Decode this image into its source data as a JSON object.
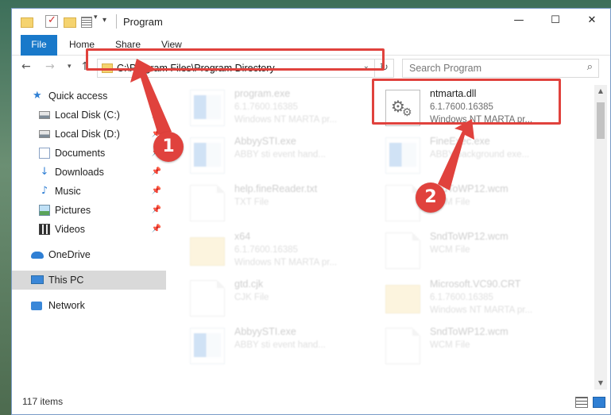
{
  "window": {
    "title": "Program",
    "controls": {
      "minimize": "—",
      "maximize": "☐",
      "close": "✕"
    }
  },
  "ribbon": {
    "tabs": [
      "File",
      "Home",
      "Share",
      "View"
    ]
  },
  "navigation": {
    "back": "←",
    "forward": "→",
    "recent": "⌄",
    "up": "↑",
    "address": "C:\\Program Files\\Program Directory",
    "refresh": "↻",
    "search_placeholder": "Search Program"
  },
  "sidebar": {
    "items": [
      {
        "label": "Quick access",
        "icon": "star-icon"
      },
      {
        "label": "Local Disk (C:)",
        "icon": "disk-icon",
        "pinned": true
      },
      {
        "label": "Local Disk (D:)",
        "icon": "disk-icon",
        "pinned": true
      },
      {
        "label": "Documents",
        "icon": "documents-icon",
        "pinned": true
      },
      {
        "label": "Downloads",
        "icon": "download-icon",
        "pinned": true
      },
      {
        "label": "Music",
        "icon": "music-icon",
        "pinned": true
      },
      {
        "label": "Pictures",
        "icon": "pictures-icon",
        "pinned": true
      },
      {
        "label": "Videos",
        "icon": "videos-icon",
        "pinned": true
      },
      {
        "label": "OneDrive",
        "icon": "cloud-icon"
      },
      {
        "label": "This PC",
        "icon": "computer-icon",
        "selected": true
      },
      {
        "label": "Network",
        "icon": "network-icon"
      }
    ],
    "pin_glyph": "📌"
  },
  "files": [
    {
      "name": "program.exe",
      "meta1": "6.1.7600.16385",
      "meta2": "Windows NT MARTA pr...",
      "type": "exe-setup",
      "faded": true
    },
    {
      "name": "ntmarta.dll",
      "meta1": "6.1.7600.16385",
      "meta2": "Windows NT MARTA pr...",
      "type": "dll",
      "faded": false
    },
    {
      "name": "AbbyySTI.exe",
      "meta1": "ABBY sti event hand...",
      "meta2": "",
      "type": "exe",
      "faded": true
    },
    {
      "name": "FineExec.exe",
      "meta1": "ABBY background exe...",
      "meta2": "",
      "type": "exe",
      "faded": true
    },
    {
      "name": "help.fineReader.txt",
      "meta1": "TXT File",
      "meta2": "",
      "type": "doc",
      "faded": true
    },
    {
      "name": "SndToWP12.wcm",
      "meta1": "WCM File",
      "meta2": "",
      "type": "doc",
      "faded": true
    },
    {
      "name": "x64",
      "meta1": "6.1.7600.16385",
      "meta2": "Windows NT MARTA pr...",
      "type": "folder",
      "faded": true
    },
    {
      "name": "SndToWP12.wcm",
      "meta1": "WCM File",
      "meta2": "",
      "type": "doc",
      "faded": true
    },
    {
      "name": "gtd.cjk",
      "meta1": "CJK File",
      "meta2": "",
      "type": "doc",
      "faded": true
    },
    {
      "name": "Microsoft.VC90.CRT",
      "meta1": "6.1.7600.16385",
      "meta2": "Windows NT MARTA pr...",
      "type": "folder",
      "faded": true
    },
    {
      "name": "AbbyySTI.exe",
      "meta1": "ABBY sti event hand...",
      "meta2": "",
      "type": "exe",
      "faded": true
    },
    {
      "name": "SndToWP12.wcm",
      "meta1": "WCM File",
      "meta2": "",
      "type": "doc",
      "faded": true
    }
  ],
  "status": {
    "item_count": "117 items"
  },
  "annotations": {
    "callout1": "1",
    "callout2": "2",
    "highlight_color": "#e0423d"
  },
  "colors": {
    "accent": "#1979ca",
    "selected_bg": "#d9d9d9"
  }
}
